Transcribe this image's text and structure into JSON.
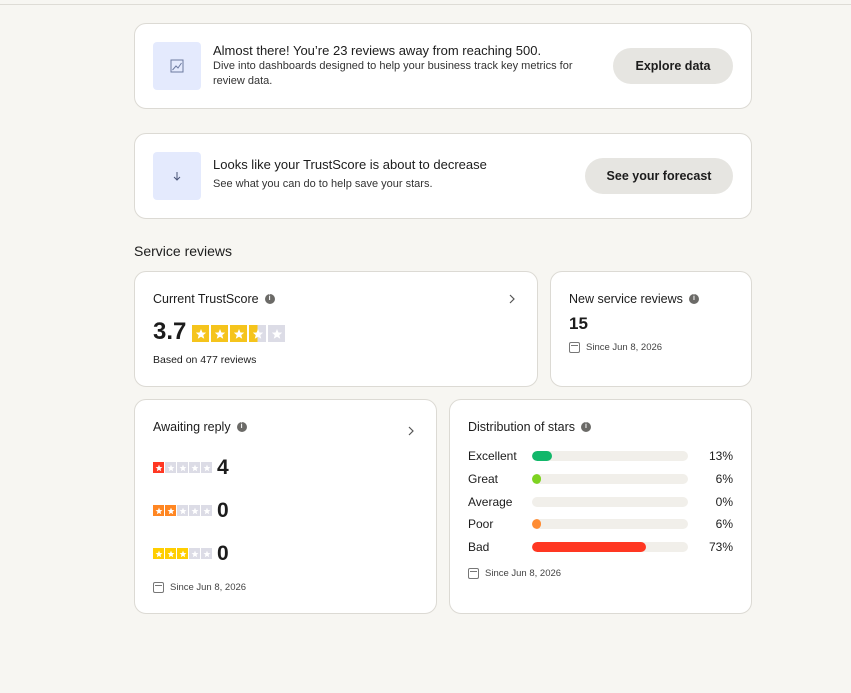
{
  "banners": [
    {
      "title": "Almost there! You’re 23 reviews away from reaching 500.",
      "description": "Dive into dashboards designed to help your business track key metrics for review data.",
      "button": "Explore data",
      "icon": "trend-chart-icon"
    },
    {
      "title": "Looks like your TrustScore is about to decrease",
      "description": "See what you can do to help save your stars.",
      "button": "See your forecast",
      "icon": "arrow-down-icon"
    }
  ],
  "section_title": "Service reviews",
  "trustscore": {
    "label": "Current TrustScore",
    "score": "3.7",
    "rating": 3.5,
    "based_on": "Based on 477 reviews"
  },
  "new_reviews": {
    "label": "New service reviews",
    "count": "15",
    "since": "Since Jun 8, 2026"
  },
  "awaiting_reply": {
    "label": "Awaiting reply",
    "rows": [
      {
        "stars": 1,
        "count": "4"
      },
      {
        "stars": 2,
        "count": "0"
      },
      {
        "stars": 3,
        "count": "0"
      }
    ],
    "since": "Since Jun 8, 2026"
  },
  "distribution": {
    "label": "Distribution of stars",
    "rows": [
      {
        "label": "Excellent",
        "percent": 13,
        "percent_text": "13%",
        "color": "#12b76a"
      },
      {
        "label": "Great",
        "percent": 6,
        "percent_text": "6%",
        "color": "#7ed321"
      },
      {
        "label": "Average",
        "percent": 0,
        "percent_text": "0%",
        "color": "#f5c41c"
      },
      {
        "label": "Poor",
        "percent": 6,
        "percent_text": "6%",
        "color": "#ff8c33"
      },
      {
        "label": "Bad",
        "percent": 73,
        "percent_text": "73%",
        "color": "#ff3722"
      }
    ],
    "since": "Since Jun 8, 2026"
  },
  "colors": {
    "star_gold": "#f5c41c",
    "star_empty": "#dcdce6",
    "one_star": "#ff3722",
    "two_star": "#ff8622",
    "three_star": "#ffce00",
    "icon_tile": "#e4eafd"
  }
}
